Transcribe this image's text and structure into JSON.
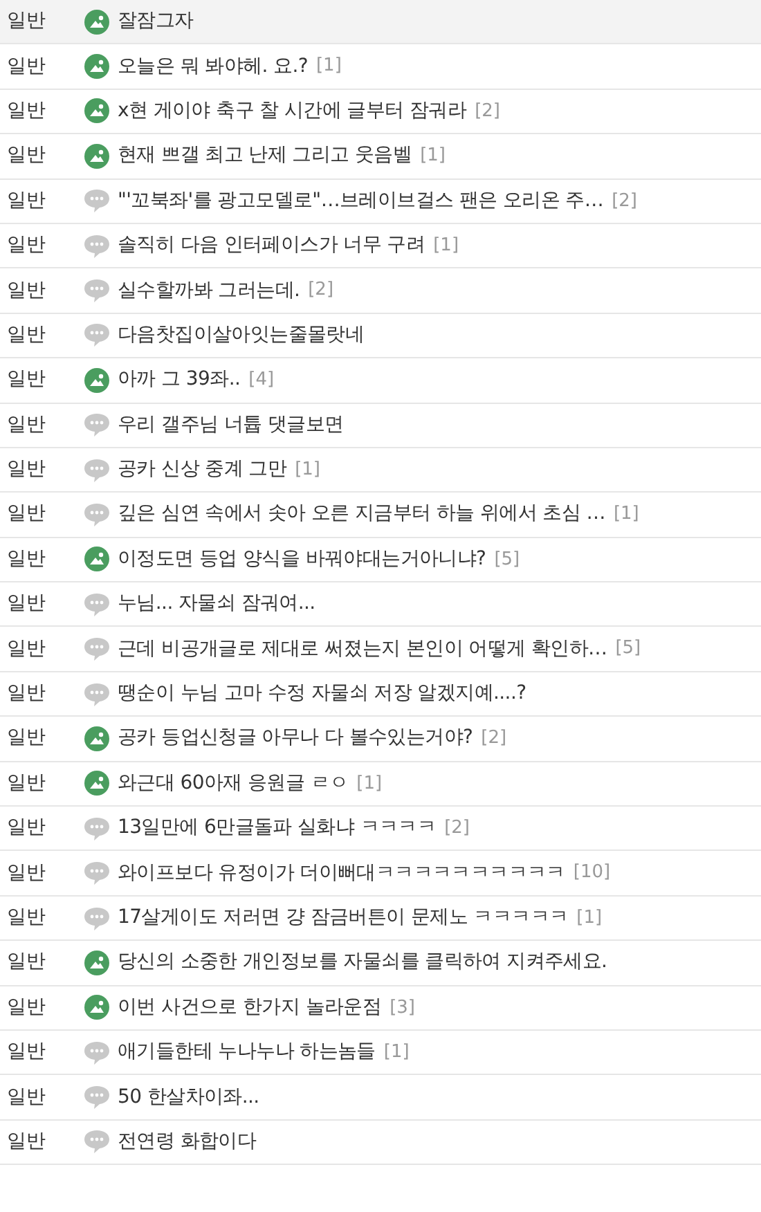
{
  "posts": [
    {
      "category": "일반",
      "kind": "image",
      "title": "잘잠그자",
      "selected": true
    },
    {
      "category": "일반",
      "kind": "image",
      "title": "오늘은 뭐 봐야헤. 요.?",
      "comments": "[1]",
      "selected": false
    },
    {
      "category": "일반",
      "kind": "image",
      "title": "x현 게이야 축구 찰 시간에 글부터 잠궈라",
      "comments": "[2]",
      "selected": false
    },
    {
      "category": "일반",
      "kind": "image",
      "title": "현재 쁘갤 최고 난제 그리고 웃음벨",
      "comments": "[1]",
      "selected": false
    },
    {
      "category": "일반",
      "kind": "text",
      "title": "\"'꼬북좌'를 광고모델로\"…브레이브걸스 팬은 오리온 주…",
      "comments": "[2]",
      "selected": false
    },
    {
      "category": "일반",
      "kind": "text",
      "title": "솔직히 다음 인터페이스가 너무 구려",
      "comments": "[1]",
      "selected": false
    },
    {
      "category": "일반",
      "kind": "text",
      "title": "실수할까봐 그러는데.",
      "comments": "[2]",
      "selected": false
    },
    {
      "category": "일반",
      "kind": "text",
      "title": "다음찻집이살아잇는줄몰랏네",
      "selected": false
    },
    {
      "category": "일반",
      "kind": "image",
      "title": "아까 그 39좌..",
      "comments": "[4]",
      "selected": false
    },
    {
      "category": "일반",
      "kind": "text",
      "title": "우리 갤주님 너튭 댓글보면",
      "selected": false
    },
    {
      "category": "일반",
      "kind": "text",
      "title": "공카 신상 중계 그만",
      "comments": "[1]",
      "selected": false
    },
    {
      "category": "일반",
      "kind": "text",
      "title": "깊은 심연 속에서 솟아 오른 지금부터 하늘 위에서 초심 …",
      "comments": "[1]",
      "selected": false
    },
    {
      "category": "일반",
      "kind": "image",
      "title": "이정도면 등업 양식을 바꿔야대는거아니냐?",
      "comments": "[5]",
      "selected": false
    },
    {
      "category": "일반",
      "kind": "text",
      "title": "누님... 자물쇠 잠궈여...",
      "selected": false
    },
    {
      "category": "일반",
      "kind": "text",
      "title": "근데 비공개글로 제대로 써졌는지 본인이 어떻게 확인하…",
      "comments": "[5]",
      "selected": false
    },
    {
      "category": "일반",
      "kind": "text",
      "title": "땡순이 누님 고마 수정 자물쇠 저장 알겠지예....?",
      "selected": false
    },
    {
      "category": "일반",
      "kind": "image",
      "title": "공카 등업신청글 아무나 다 볼수있는거야?",
      "comments": "[2]",
      "selected": false
    },
    {
      "category": "일반",
      "kind": "image",
      "title": "와근대 60아재 응원글 ㄹㅇ",
      "comments": "[1]",
      "selected": false
    },
    {
      "category": "일반",
      "kind": "text",
      "title": "13일만에 6만글돌파 실화냐 ㅋㅋㅋㅋ",
      "comments": "[2]",
      "selected": false
    },
    {
      "category": "일반",
      "kind": "text",
      "title": "와이프보다 유정이가 더이뻐대ㅋㅋㅋㅋㅋㅋㅋㅋㅋㅋ",
      "comments": "[10]",
      "selected": false
    },
    {
      "category": "일반",
      "kind": "text",
      "title": "17살게이도 저러면 걍 잠금버튼이 문제노 ㅋㅋㅋㅋㅋ",
      "comments": "[1]",
      "selected": false
    },
    {
      "category": "일반",
      "kind": "image",
      "title": "당신의 소중한 개인정보를 자물쇠를 클릭하여 지켜주세요.",
      "selected": false
    },
    {
      "category": "일반",
      "kind": "image",
      "title": "이번 사건으로 한가지 놀라운점",
      "comments": "[3]",
      "selected": false
    },
    {
      "category": "일반",
      "kind": "text",
      "title": "애기들한테 누나누나 하는놈들",
      "comments": "[1]",
      "selected": false
    },
    {
      "category": "일반",
      "kind": "text",
      "title": "50 한살차이좌...",
      "selected": false
    },
    {
      "category": "일반",
      "kind": "text",
      "title": "전연령 화합이다",
      "selected": false
    }
  ]
}
